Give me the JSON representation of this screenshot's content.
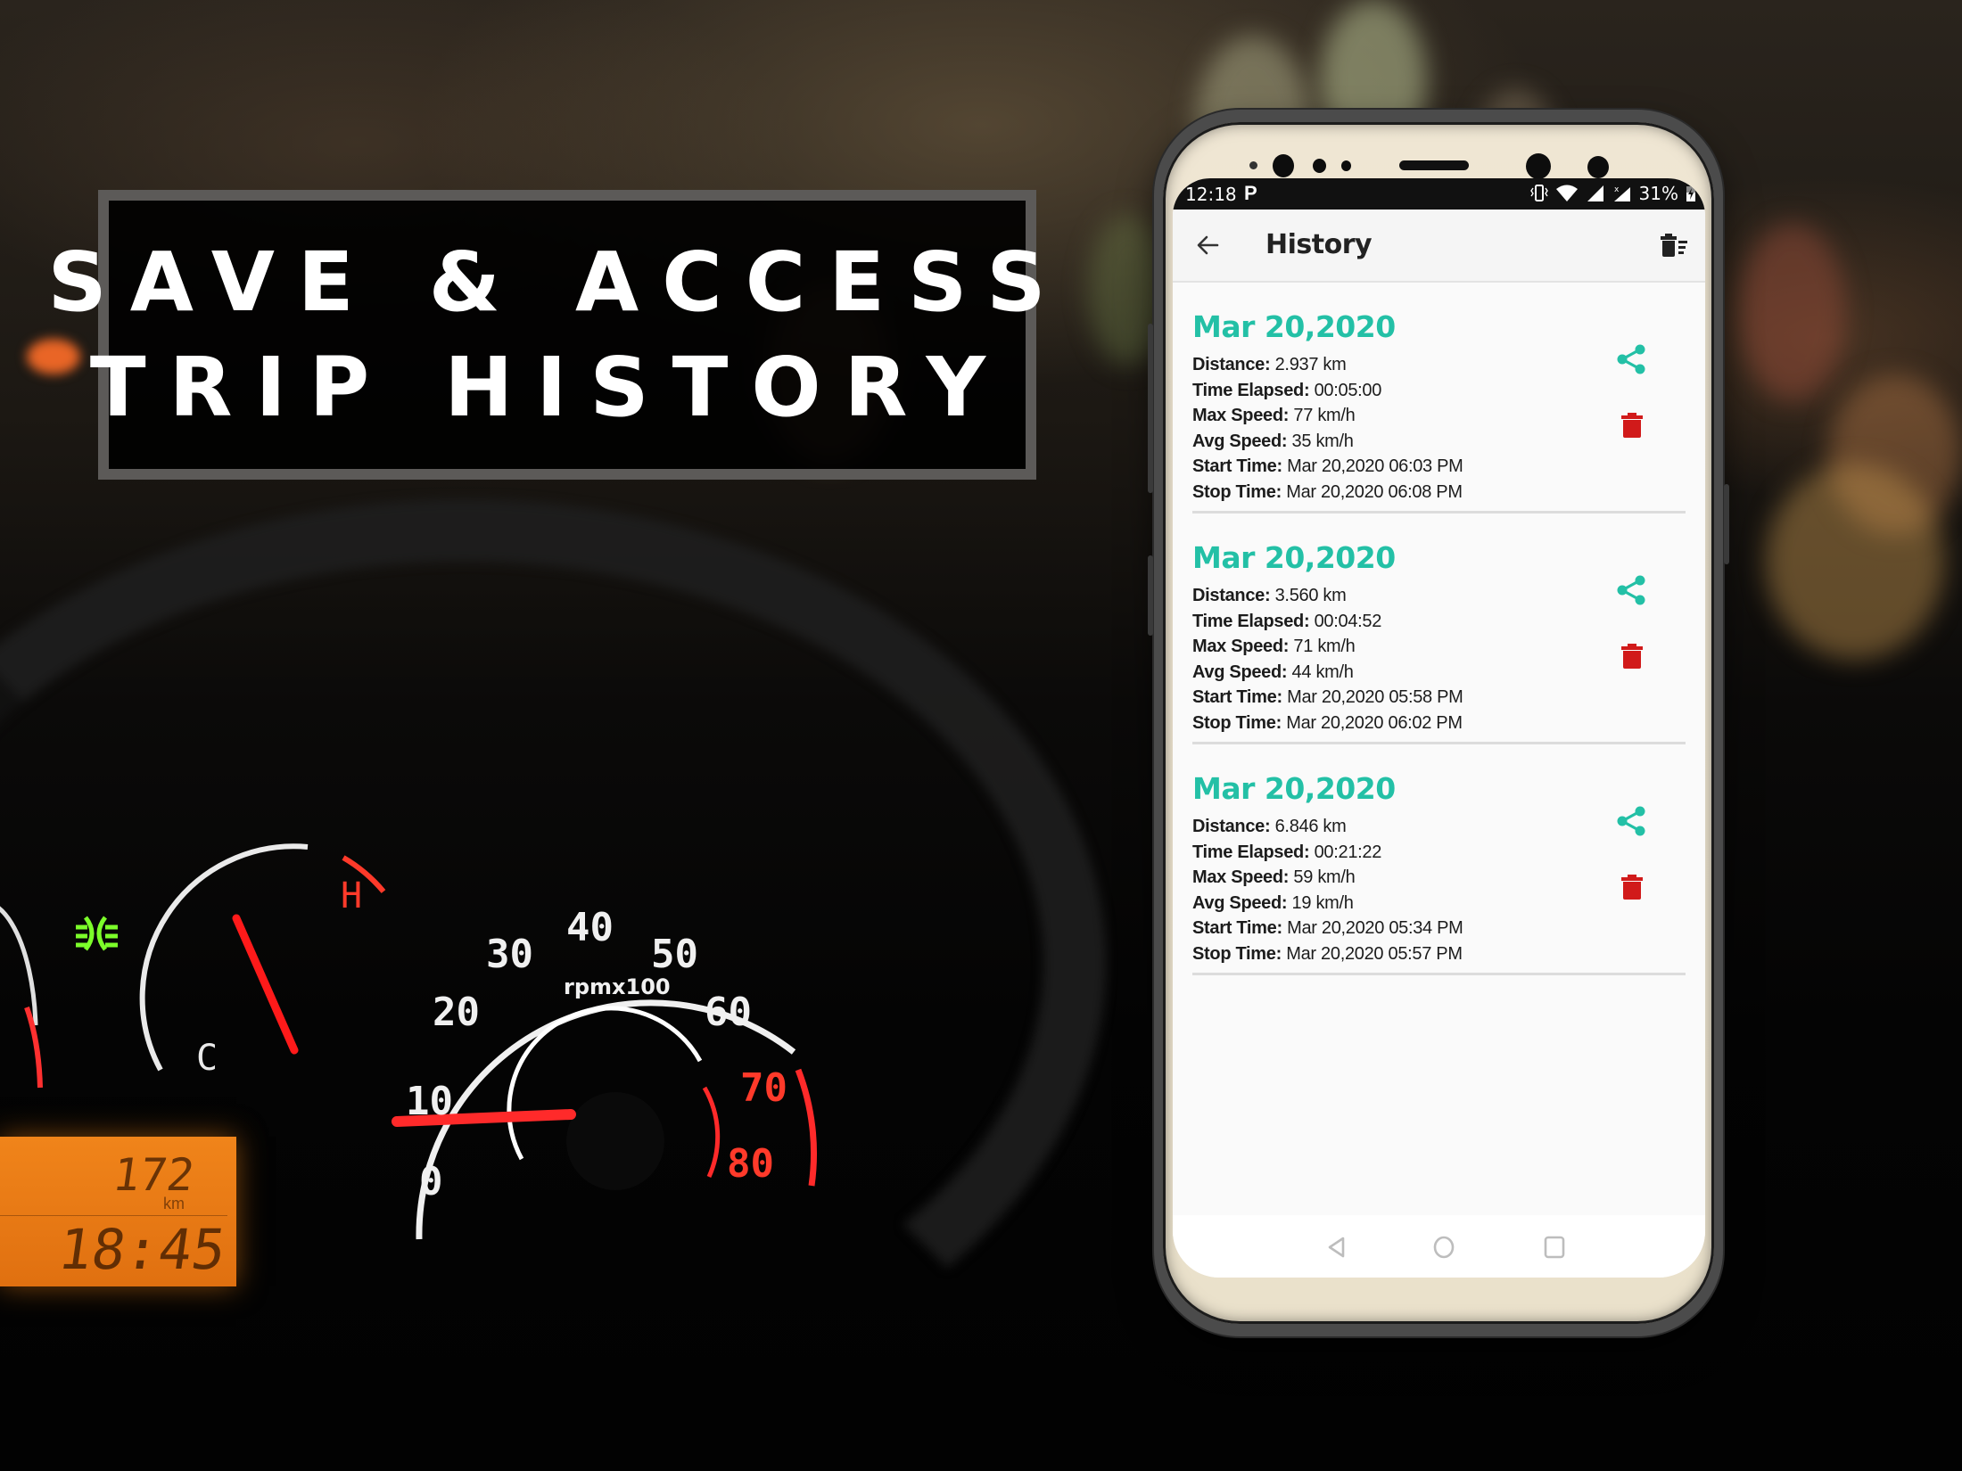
{
  "headline": {
    "line1": "SAVE & ACCESS",
    "line2": "TRIP HISTORY"
  },
  "background": {
    "gauge_unit_label": "rpmx100",
    "tach_ticks": [
      "0",
      "10",
      "20",
      "30",
      "40",
      "50",
      "60",
      "70",
      "80"
    ],
    "temp_labels": {
      "cold": "C",
      "hot": "H"
    },
    "odometer": "172",
    "odometer_unit": "km",
    "dash_clock": "18:45"
  },
  "statusbar": {
    "time": "12:18",
    "notification_icon": "parking-p-icon",
    "icons": [
      "vibrate-icon",
      "wifi-icon",
      "signal-icon",
      "signal-no-data-icon",
      "battery-charging-icon"
    ],
    "battery_percent": "31%"
  },
  "appbar": {
    "title": "History",
    "back_icon": "arrow-left-icon",
    "action_icon": "delete-all-icon"
  },
  "colors": {
    "accent": "#23c0a6",
    "delete": "#d11a1a",
    "text": "#1c1c1c"
  },
  "labels": {
    "distance": "Distance:",
    "time_elapsed": "Time Elapsed:",
    "max_speed": "Max Speed:",
    "avg_speed": "Avg Speed:",
    "start_time": "Start Time:",
    "stop_time": "Stop Time:"
  },
  "trips": [
    {
      "date": "Mar 20,2020",
      "distance": "2.937 km",
      "time_elapsed": "00:05:00",
      "max_speed": "77 km/h",
      "avg_speed": "35 km/h",
      "start_time": "Mar 20,2020 06:03 PM",
      "stop_time": "Mar 20,2020 06:08 PM"
    },
    {
      "date": "Mar 20,2020",
      "distance": "3.560 km",
      "time_elapsed": "00:04:52",
      "max_speed": "71 km/h",
      "avg_speed": "44 km/h",
      "start_time": "Mar 20,2020 05:58 PM",
      "stop_time": "Mar 20,2020 06:02 PM"
    },
    {
      "date": "Mar 20,2020",
      "distance": "6.846 km",
      "time_elapsed": "00:21:22",
      "max_speed": "59 km/h",
      "avg_speed": "19 km/h",
      "start_time": "Mar 20,2020 05:34 PM",
      "stop_time": "Mar 20,2020 05:57 PM"
    }
  ],
  "navbar": {
    "buttons": [
      "back-triangle-icon",
      "home-circle-icon",
      "recents-square-icon"
    ]
  }
}
